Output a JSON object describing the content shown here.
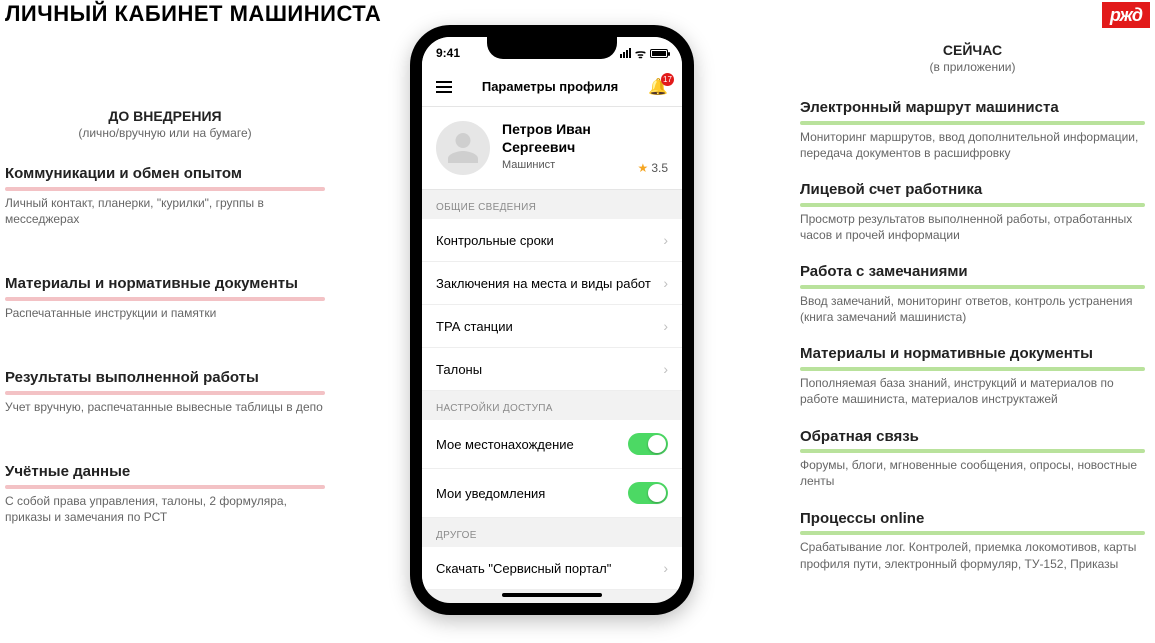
{
  "page": {
    "title": "ЛИЧНЫЙ КАБИНЕТ МАШИНИСТА",
    "logo_text": "ржд"
  },
  "left": {
    "head": "ДО ВНЕДРЕНИЯ",
    "sub": "(лично/вручную или на бумаге)",
    "items": [
      {
        "title": "Коммуникации и обмен опытом",
        "desc": "Личный контакт, планерки, \"курилки\", группы в месседжерах"
      },
      {
        "title": "Материалы и нормативные документы",
        "desc": "Распечатанные инструкции и памятки"
      },
      {
        "title": "Результаты выполненной работы",
        "desc": "Учет вручную, распечатанные вывесные таблицы в депо"
      },
      {
        "title": "Учётные данные",
        "desc": "С собой права управления, талоны, 2 формуляра, приказы и замечания по РСТ"
      }
    ]
  },
  "right": {
    "head": "СЕЙЧАС",
    "sub": "(в приложении)",
    "items": [
      {
        "title": "Электронный маршрут машиниста",
        "desc": "Мониторинг маршрутов, ввод дополнительной информации, передача документов в расшифровку"
      },
      {
        "title": "Лицевой счет работника",
        "desc": "Просмотр результатов выполненной работы, отработанных часов и прочей информации"
      },
      {
        "title": "Работа с замечаниями",
        "desc": "Ввод замечаний, мониторинг ответов, контроль устранения (книга замечаний машиниста)"
      },
      {
        "title": "Материалы и нормативные документы",
        "desc": "Пополняемая база знаний, инструкций и материалов по работе машиниста, материалов инструктажей"
      },
      {
        "title": "Обратная связь",
        "desc": "Форумы, блоги, мгновенные сообщения, опросы, новостные ленты"
      },
      {
        "title": "Процессы online",
        "desc": "Срабатывание лог. Контролей, приемка локомотивов, карты профиля пути, электронный формуляр, ТУ-152, Приказы"
      }
    ]
  },
  "phone": {
    "time": "9:41",
    "wifi_glyph": "ᯤ",
    "nav_title": "Параметры профиля",
    "bell_count": "17",
    "profile": {
      "name": "Петров Иван Сергеевич",
      "role": "Машинист",
      "rating": "3.5"
    },
    "sections": {
      "general_label": "ОБЩИЕ СВЕДЕНИЯ",
      "general_items": [
        "Контрольные сроки",
        "Заключения на места и виды работ",
        "ТРА станции",
        "Талоны"
      ],
      "access_label": "НАСТРОЙКИ ДОСТУПА",
      "access_items": [
        "Мое местонахождение",
        "Мои уведомления"
      ],
      "other_label": "ДРУГОЕ",
      "other_items": [
        "Скачать \"Сервисный портал\""
      ]
    }
  }
}
